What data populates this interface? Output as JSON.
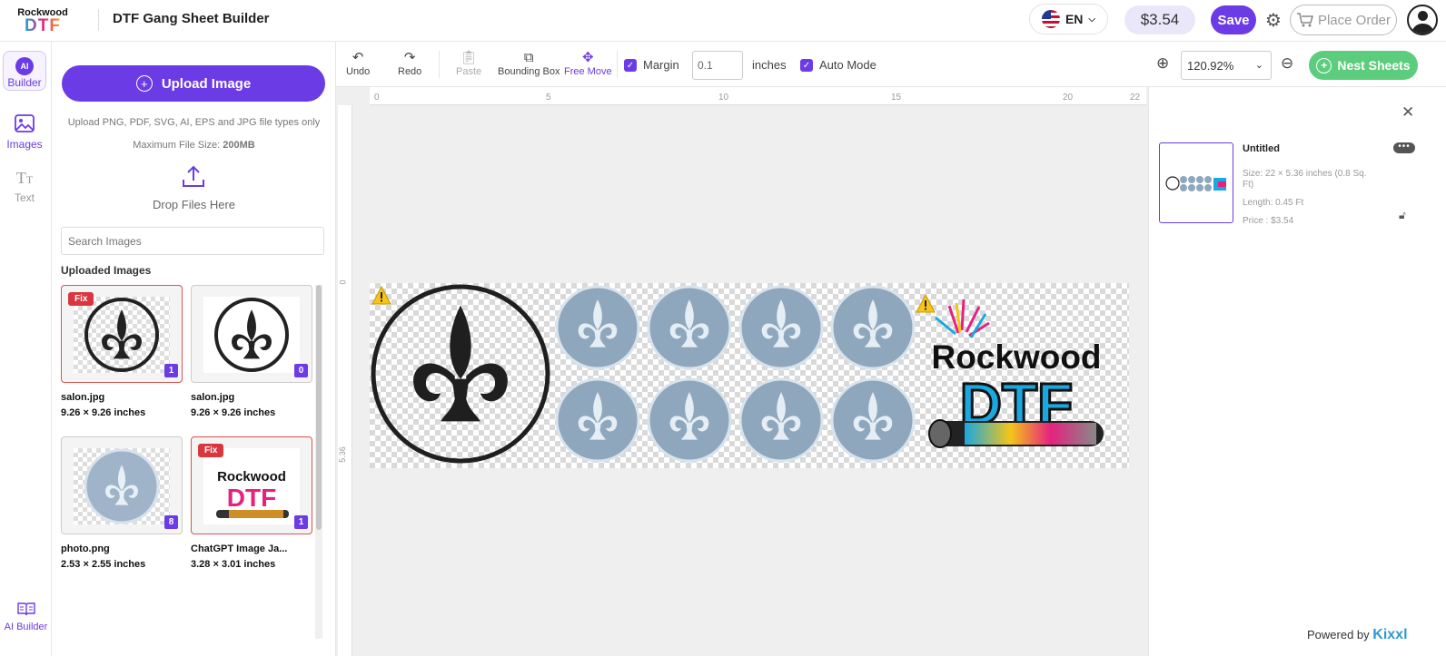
{
  "header": {
    "logo_line1": "Rockwood",
    "logo_line2": "DTF",
    "title": "DTF Gang Sheet Builder",
    "lang": "EN",
    "price": "$3.54",
    "save_label": "Save",
    "place_order_label": "Place Order"
  },
  "rail": {
    "builder": "Builder",
    "images": "Images",
    "text": "Text",
    "ai_builder": "AI Builder",
    "ai_short": "AI"
  },
  "upload": {
    "button": "Upload Image",
    "types_hint": "Upload PNG, PDF, SVG, AI, EPS and JPG file types only",
    "max_size_prefix": "Maximum File Size: ",
    "max_size_value": "200MB",
    "drop": "Drop Files Here",
    "search_placeholder": "Search Images",
    "section_label": "Uploaded Images",
    "fix_label": "Fix",
    "items": [
      {
        "name": "salon.jpg",
        "size": "9.26 × 9.26 inches",
        "count": "1"
      },
      {
        "name": "salon.jpg",
        "size": "9.26 × 9.26 inches",
        "count": "0"
      },
      {
        "name": "photo.png",
        "size": "2.53 × 2.55 inches",
        "count": "8"
      },
      {
        "name": "ChatGPT Image Ja...",
        "size": "3.28 × 3.01 inches",
        "count": "1"
      }
    ]
  },
  "toolbar": {
    "undo": "Undo",
    "redo": "Redo",
    "paste": "Paste",
    "bounding_box": "Bounding Box",
    "free_move": "Free Move",
    "margin_label": "Margin",
    "margin_value": "0.1",
    "margin_unit": "inches",
    "auto_mode": "Auto Mode",
    "zoom": "120.92%",
    "nest": "Nest Sheets"
  },
  "ruler": {
    "top": [
      "0",
      "5",
      "10",
      "15",
      "20",
      "22"
    ],
    "left_start": "0",
    "left_end": "5.36"
  },
  "sheet": {
    "name": "Untitled",
    "size": "Size: 22 × 5.36 inches (0.8 Sq. Ft)",
    "length": "Length: 0.45 Ft",
    "price": "Price : $3.54"
  },
  "footer": {
    "powered_by": "Powered by",
    "brand": "Kixxl"
  },
  "colors": {
    "accent": "#6b3be6",
    "nest": "#5ccd7d",
    "fix": "#d9363e"
  }
}
